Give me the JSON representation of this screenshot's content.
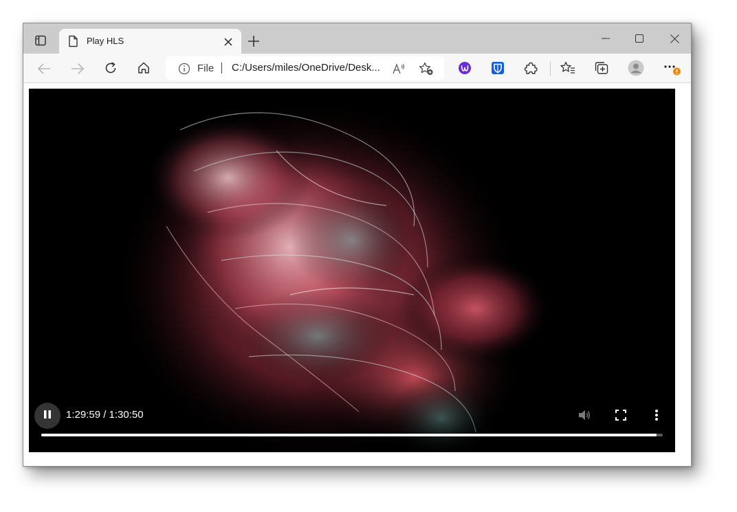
{
  "browser": {
    "tab": {
      "title": "Play HLS"
    },
    "address_bar": {
      "info_label": "File",
      "url": "C:/Users/miles/OneDrive/Desk..."
    },
    "icons": [
      "tab-actions-icon",
      "page-icon",
      "close-icon",
      "new-tab-icon",
      "minimize-icon",
      "maximize-icon",
      "window-close-icon",
      "back-icon",
      "forward-icon",
      "refresh-icon",
      "home-icon",
      "info-icon",
      "read-aloud-icon",
      "add-favorite-icon",
      "extension-purple-icon",
      "bitwarden-icon",
      "extensions-icon",
      "favorites-icon",
      "collections-icon",
      "profile-icon",
      "more-icon"
    ]
  },
  "video_player": {
    "time_display": "1:29:59 / 1:30:50",
    "current_time_seconds": 5399,
    "duration_seconds": 5450,
    "progress_fraction": 0.99,
    "controls": [
      "pause",
      "mute",
      "fullscreen",
      "more-options"
    ]
  },
  "colors": {
    "tabstrip": "#cccccc",
    "toolbar": "#f7f7f7",
    "video_bg": "#000000",
    "notification_badge": "#f08a00",
    "bitwarden": "#175ddc",
    "purple_extension": "#6b2bd9"
  }
}
